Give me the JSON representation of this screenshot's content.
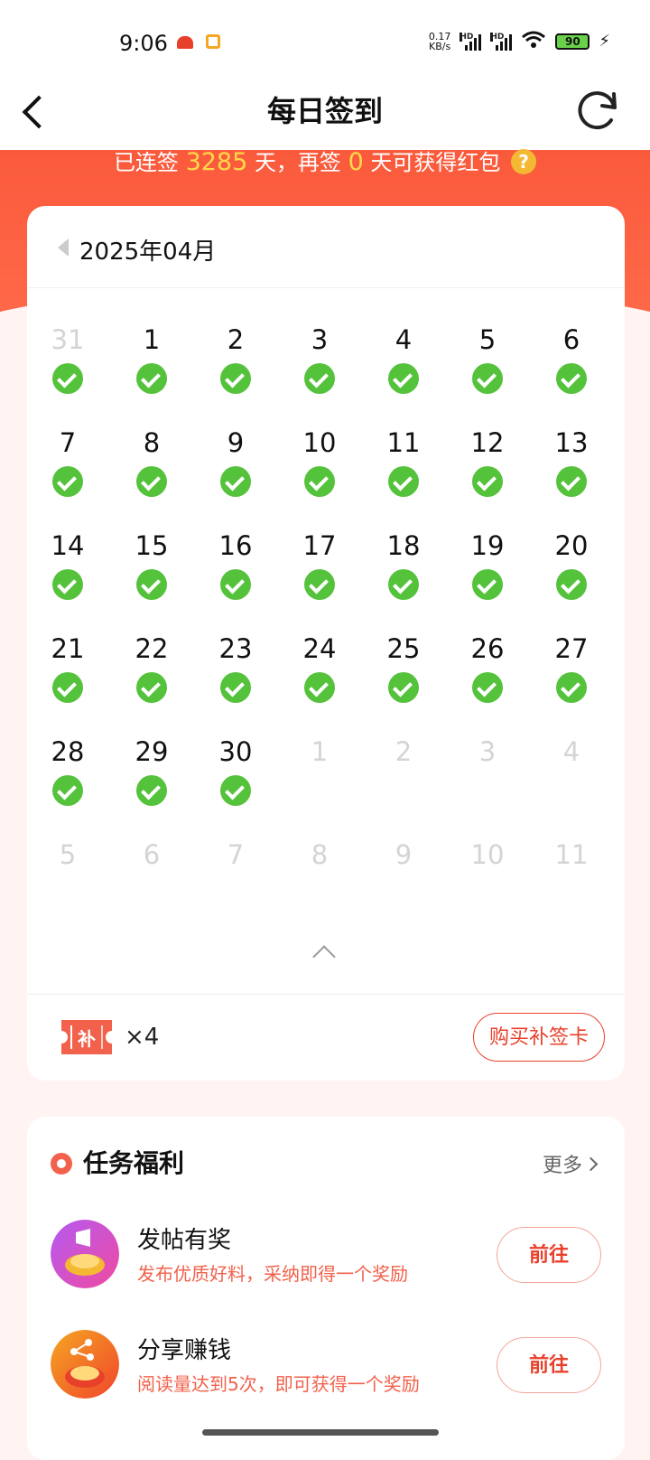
{
  "status_bar": {
    "time": "9:06",
    "speed_value": "0.17",
    "speed_unit": "KB/s",
    "signal_tag": "HD",
    "battery": "90"
  },
  "header": {
    "title": "每日签到"
  },
  "streak": {
    "prefix": "已连签",
    "days": "3285",
    "mid": "天，再签",
    "remaining": "0",
    "suffix": "天可获得红包",
    "help": "?"
  },
  "calendar": {
    "month": "2025年04月",
    "rows": [
      [
        {
          "d": "31",
          "muted": true,
          "checked": true
        },
        {
          "d": "1",
          "checked": true
        },
        {
          "d": "2",
          "checked": true
        },
        {
          "d": "3",
          "checked": true
        },
        {
          "d": "4",
          "checked": true
        },
        {
          "d": "5",
          "checked": true
        },
        {
          "d": "6",
          "checked": true
        }
      ],
      [
        {
          "d": "7",
          "checked": true
        },
        {
          "d": "8",
          "checked": true
        },
        {
          "d": "9",
          "checked": true
        },
        {
          "d": "10",
          "checked": true
        },
        {
          "d": "11",
          "checked": true
        },
        {
          "d": "12",
          "checked": true
        },
        {
          "d": "13",
          "checked": true
        }
      ],
      [
        {
          "d": "14",
          "checked": true
        },
        {
          "d": "15",
          "checked": true
        },
        {
          "d": "16",
          "checked": true
        },
        {
          "d": "17",
          "checked": true
        },
        {
          "d": "18",
          "checked": true
        },
        {
          "d": "19",
          "checked": true
        },
        {
          "d": "20",
          "checked": true
        }
      ],
      [
        {
          "d": "21",
          "checked": true
        },
        {
          "d": "22",
          "checked": true
        },
        {
          "d": "23",
          "checked": true
        },
        {
          "d": "24",
          "checked": true
        },
        {
          "d": "25",
          "checked": true
        },
        {
          "d": "26",
          "checked": true
        },
        {
          "d": "27",
          "checked": true
        }
      ],
      [
        {
          "d": "28",
          "checked": true
        },
        {
          "d": "29",
          "checked": true
        },
        {
          "d": "30",
          "checked": true
        },
        {
          "d": "1",
          "muted": true
        },
        {
          "d": "2",
          "muted": true
        },
        {
          "d": "3",
          "muted": true
        },
        {
          "d": "4",
          "muted": true
        }
      ],
      [
        {
          "d": "5",
          "muted": true
        },
        {
          "d": "6",
          "muted": true
        },
        {
          "d": "7",
          "muted": true
        },
        {
          "d": "8",
          "muted": true
        },
        {
          "d": "9",
          "muted": true
        },
        {
          "d": "10",
          "muted": true
        },
        {
          "d": "11",
          "muted": true
        }
      ]
    ],
    "ticket_label": "补",
    "ticket_count": "×4",
    "buy_label": "购买补签卡"
  },
  "tasks": {
    "title": "任务福利",
    "more": "更多",
    "items": [
      {
        "name": "发帖有奖",
        "desc": "发布优质好料，采纳即得一个奖励",
        "button": "前往",
        "icon": "megaphone-icon"
      },
      {
        "name": "分享赚钱",
        "desc": "阅读量达到5次，即可获得一个奖励",
        "button": "前往",
        "icon": "share-icon"
      }
    ]
  },
  "colors": {
    "brand_red": "#fa5a3c",
    "check_green": "#55c23c",
    "highlight_yellow": "#ffd84a"
  }
}
